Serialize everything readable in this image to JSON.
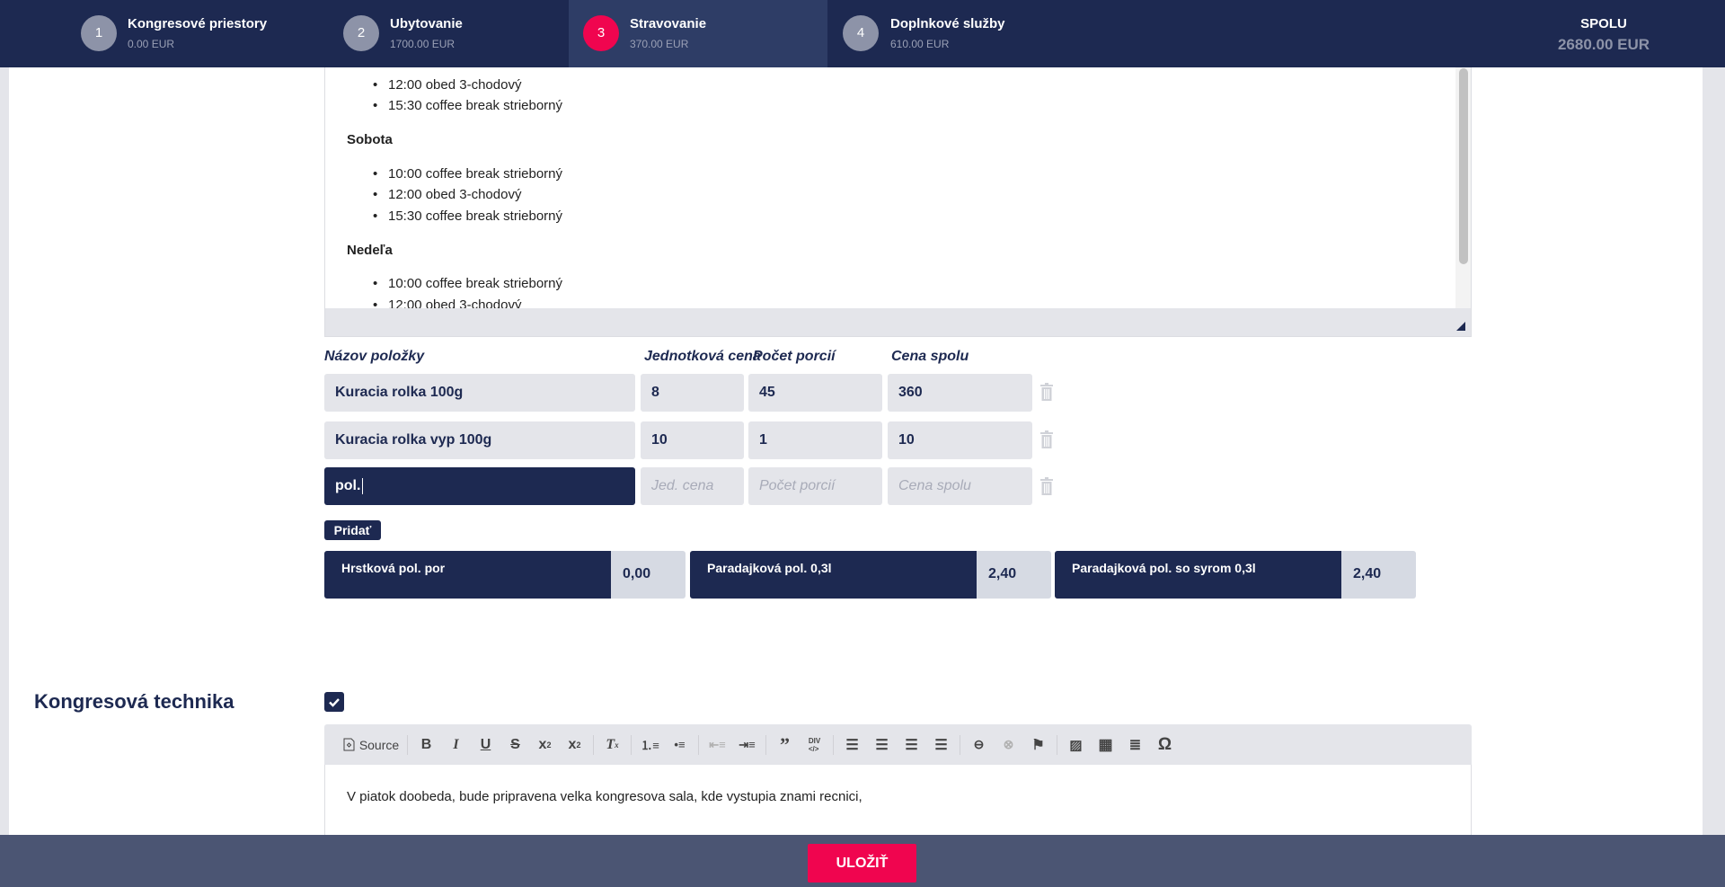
{
  "header": {
    "steps": [
      {
        "number": "1",
        "title": "Kongresové priestory",
        "amount": "0.00 EUR"
      },
      {
        "number": "2",
        "title": "Ubytovanie",
        "amount": "1700.00 EUR"
      },
      {
        "number": "3",
        "title": "Stravovanie",
        "amount": "370.00 EUR"
      },
      {
        "number": "4",
        "title": "Doplnkové služby",
        "amount": "610.00 EUR"
      }
    ],
    "total_label": "SPOLU",
    "total_value": "2680.00 EUR",
    "active_step": 3,
    "colors": {
      "navy": "#1d2951",
      "accent": "#f0054f"
    }
  },
  "menu_editor": {
    "items_top": [
      "12:00 obed 3-chodový",
      "15:30 coffee break strieborný"
    ],
    "days": [
      {
        "name": "Sobota",
        "items": [
          "10:00 coffee break strieborný",
          "12:00 obed 3-chodový",
          "15:30 coffee break strieborný"
        ]
      },
      {
        "name": "Nedeľa",
        "items": [
          "10:00 coffee break strieborný",
          "12:00 obed 3-chodový"
        ]
      }
    ]
  },
  "items_table": {
    "headers": [
      "Názov položky",
      "Jednotková cena",
      "Počet porcií",
      "Cena spolu"
    ],
    "rows": [
      {
        "name": "Kuracia rolka 100g",
        "unit": "8",
        "count": "45",
        "total": "360"
      },
      {
        "name": "Kuracia rolka vyp 100g",
        "unit": "10",
        "count": "1",
        "total": "10"
      }
    ],
    "new_row": {
      "name": "pol.",
      "unit_placeholder": "Jed. cena",
      "count_placeholder": "Počet porcií",
      "total_placeholder": "Cena spolu"
    },
    "add_label": "Pridať"
  },
  "suggestions": [
    {
      "name": "Hrstková pol. por",
      "price": "0,00"
    },
    {
      "name": "Paradajková pol. 0,3l",
      "price": "2,40"
    },
    {
      "name": "Paradajková pol. so syrom 0,3l",
      "price": "2,40"
    }
  ],
  "kongresova_technika": {
    "label": "Kongresová technika",
    "checked": true,
    "toolbar_source_label": "Source",
    "content": "V piatok doobeda, bude pripravena velka kongresova sala, kde vystupia znami recnici,"
  },
  "footer": {
    "save_label": "ULOŽIŤ"
  }
}
